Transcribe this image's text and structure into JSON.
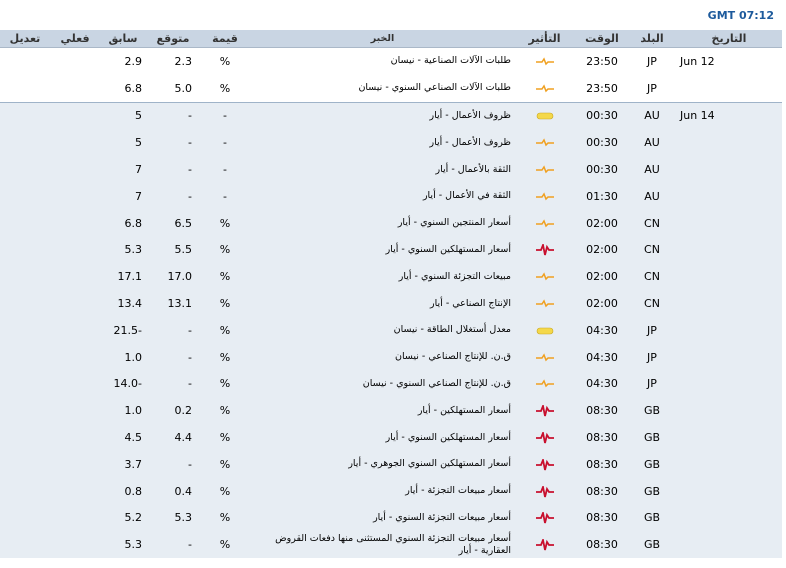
{
  "gmt_clock": "GMT 07:12",
  "headers": {
    "date": "التاريخ",
    "country": "البلد",
    "time": "الوقت",
    "impact": "التأثير",
    "news": "الخبر",
    "unit": "قيمة",
    "forecast": "متوقع",
    "previous": "سابق",
    "actual": "فعلي",
    "revision": "تعديل"
  },
  "rows": [
    {
      "date": "Jun 12",
      "country": "JP",
      "time": "23:50",
      "impact": "medium",
      "news": "طلبات الآلات الصناعية - نيسان",
      "unit": "%",
      "forecast": "2.3",
      "previous": "2.9",
      "actual": "",
      "revision": ""
    },
    {
      "date": "",
      "country": "JP",
      "time": "23:50",
      "impact": "medium",
      "news": "طلبات الآلات الصناعي السنوي - نيسان",
      "unit": "%",
      "forecast": "5.0",
      "previous": "6.8",
      "actual": "",
      "revision": ""
    },
    {
      "date": "Jun 14",
      "country": "AU",
      "time": "00:30",
      "impact": "low",
      "news": "ظروف الأعمال - أيار",
      "unit": "-",
      "forecast": "-",
      "previous": "5",
      "actual": "",
      "revision": ""
    },
    {
      "date": "",
      "country": "AU",
      "time": "00:30",
      "impact": "medium",
      "news": "ظروف الأعمال - أيار",
      "unit": "-",
      "forecast": "-",
      "previous": "5",
      "actual": "",
      "revision": ""
    },
    {
      "date": "",
      "country": "AU",
      "time": "00:30",
      "impact": "medium",
      "news": "الثقة بالأعمال - أيار",
      "unit": "-",
      "forecast": "-",
      "previous": "7",
      "actual": "",
      "revision": ""
    },
    {
      "date": "",
      "country": "AU",
      "time": "01:30",
      "impact": "medium",
      "news": "الثقة في الأعمال - أيار",
      "unit": "-",
      "forecast": "-",
      "previous": "7",
      "actual": "",
      "revision": ""
    },
    {
      "date": "",
      "country": "CN",
      "time": "02:00",
      "impact": "medium",
      "news": "أسعار المنتجين السنوي - أيار",
      "unit": "%",
      "forecast": "6.5",
      "previous": "6.8",
      "actual": "",
      "revision": ""
    },
    {
      "date": "",
      "country": "CN",
      "time": "02:00",
      "impact": "high",
      "news": "أسعار المستهلكين السنوي - أيار",
      "unit": "%",
      "forecast": "5.5",
      "previous": "5.3",
      "actual": "",
      "revision": ""
    },
    {
      "date": "",
      "country": "CN",
      "time": "02:00",
      "impact": "medium",
      "news": "مبيعات التجزئة السنوي - أيار",
      "unit": "%",
      "forecast": "17.0",
      "previous": "17.1",
      "actual": "",
      "revision": ""
    },
    {
      "date": "",
      "country": "CN",
      "time": "02:00",
      "impact": "medium",
      "news": "الإنتاج الصناعي - أيار",
      "unit": "%",
      "forecast": "13.1",
      "previous": "13.4",
      "actual": "",
      "revision": ""
    },
    {
      "date": "",
      "country": "JP",
      "time": "04:30",
      "impact": "low",
      "news": "معدل أستغلال الطاقة - نيسان",
      "unit": "%",
      "forecast": "-",
      "previous": "21.5-",
      "actual": "",
      "revision": ""
    },
    {
      "date": "",
      "country": "JP",
      "time": "04:30",
      "impact": "medium",
      "news": "ق.ن. للإنتاج الصناعي - نيسان",
      "unit": "%",
      "forecast": "-",
      "previous": "1.0",
      "actual": "",
      "revision": ""
    },
    {
      "date": "",
      "country": "JP",
      "time": "04:30",
      "impact": "medium",
      "news": "ق.ن. للإنتاج الصناعي السنوي - نيسان",
      "unit": "%",
      "forecast": "-",
      "previous": "14.0-",
      "actual": "",
      "revision": ""
    },
    {
      "date": "",
      "country": "GB",
      "time": "08:30",
      "impact": "high",
      "news": "أسعار المستهلكين - أيار",
      "unit": "%",
      "forecast": "0.2",
      "previous": "1.0",
      "actual": "",
      "revision": ""
    },
    {
      "date": "",
      "country": "GB",
      "time": "08:30",
      "impact": "high",
      "news": "أسعار المستهلكين السنوي - أيار",
      "unit": "%",
      "forecast": "4.4",
      "previous": "4.5",
      "actual": "",
      "revision": ""
    },
    {
      "date": "",
      "country": "GB",
      "time": "08:30",
      "impact": "high",
      "news": "أسعار المستهلكين السنوي الجوهري - أيار",
      "unit": "%",
      "forecast": "-",
      "previous": "3.7",
      "actual": "",
      "revision": ""
    },
    {
      "date": "",
      "country": "GB",
      "time": "08:30",
      "impact": "high",
      "news": "أسعار مبيعات التجزئة - أيار",
      "unit": "%",
      "forecast": "0.4",
      "previous": "0.8",
      "actual": "",
      "revision": ""
    },
    {
      "date": "",
      "country": "GB",
      "time": "08:30",
      "impact": "high",
      "news": "أسعار مبيعات التجزئة السنوي - أيار",
      "unit": "%",
      "forecast": "5.3",
      "previous": "5.2",
      "actual": "",
      "revision": ""
    },
    {
      "date": "",
      "country": "GB",
      "time": "08:30",
      "impact": "high",
      "news": "أسعار مبيعات التجزئة السنوي المستثنى منها دفعات القروض العقارية - أيار",
      "unit": "%",
      "forecast": "-",
      "previous": "5.3",
      "actual": "",
      "revision": ""
    }
  ],
  "impact_colors": {
    "low": "#f4d84a",
    "medium": "#f0a020",
    "high": "#c8102e"
  }
}
